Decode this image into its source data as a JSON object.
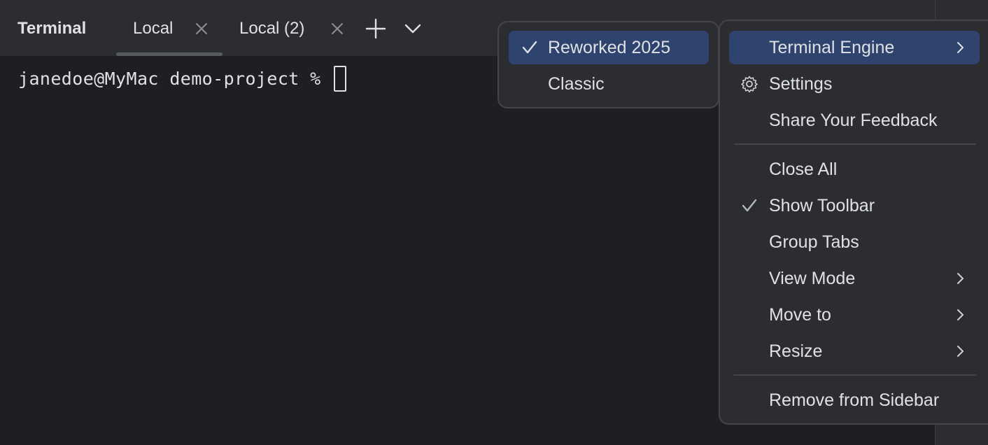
{
  "tool_window": {
    "title": "Terminal"
  },
  "tabs": [
    {
      "label": "Local",
      "active": true
    },
    {
      "label": "Local (2)",
      "active": false
    }
  ],
  "toolbar": {
    "new_tab_icon": "plus-icon",
    "tab_list_icon": "chevron-down-icon",
    "close_tab_icon": "close-icon"
  },
  "terminal": {
    "prompt": "janedoe@MyMac demo-project %"
  },
  "engine_submenu": {
    "items": [
      {
        "label": "Reworked 2025",
        "checked": true,
        "selected": true
      },
      {
        "label": "Classic",
        "checked": false,
        "selected": false
      }
    ]
  },
  "options_menu": {
    "items": [
      {
        "label": "Terminal Engine",
        "has_submenu": true,
        "selected": true
      },
      {
        "label": "Settings",
        "icon": "gear-icon"
      },
      {
        "label": "Share Your Feedback"
      },
      {
        "label": "Close All"
      },
      {
        "label": "Show Toolbar",
        "checked": true
      },
      {
        "label": "Group Tabs"
      },
      {
        "label": "View Mode",
        "has_submenu": true
      },
      {
        "label": "Move to",
        "has_submenu": true
      },
      {
        "label": "Resize",
        "has_submenu": true
      },
      {
        "label": "Remove from Sidebar"
      }
    ]
  },
  "colors": {
    "background": "#1e1f22",
    "panel": "#2b2d30",
    "selection": "#2e436e",
    "text": "#dfe1e5",
    "muted": "#8c8f94"
  }
}
